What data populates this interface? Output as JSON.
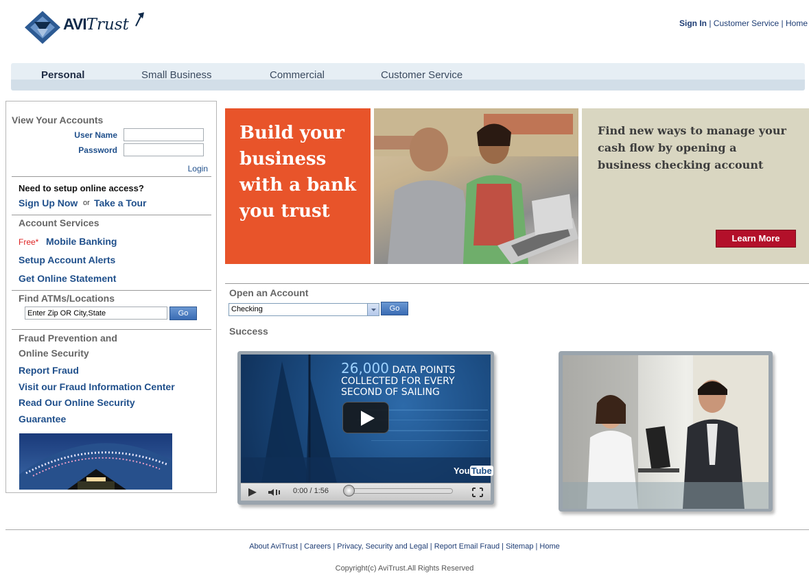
{
  "brand": {
    "logo_text_a": "AVI",
    "logo_text_b": "Trust"
  },
  "top_links": {
    "sign_in": "Sign In",
    "customer_service": "Customer Service",
    "home": "Home",
    "separator": "|"
  },
  "nav": {
    "personal": "Personal",
    "small_business": "Small Business",
    "commercial": "Commercial",
    "customer_service": "Customer Service"
  },
  "sidebar": {
    "view_accounts": "View Your Accounts",
    "user_name_label": "User Name",
    "password_label": "Password",
    "login": "Login",
    "setup_question": "Need to setup online access?",
    "sign_up": "Sign Up Now",
    "or": "or",
    "take_tour": "Take a Tour",
    "account_services": "Account Services",
    "free": "Free*",
    "mobile_banking": "Mobile Banking",
    "account_alerts": "Setup Account Alerts",
    "online_statement": "Get Online Statement",
    "find_atms": "Find ATMs/Locations",
    "zip_value": "Enter Zip OR City,State",
    "go": "Go",
    "fraud_title_1": "Fraud Prevention and",
    "fraud_title_2": "Online Security",
    "report_fraud": "Report Fraud",
    "fraud_center": "Visit our Fraud Information Center",
    "security_1": "Read Our Online Security",
    "security_2": "Guarantee"
  },
  "banner": {
    "headline": "Build your business with a bank you trust",
    "tagline": "Find new ways to manage your cash flow by opening a business checking account",
    "learn_more": "Learn More"
  },
  "open_account": {
    "title": "Open an Account",
    "selected": "Checking",
    "go": "Go"
  },
  "success": {
    "title": "Success"
  },
  "video": {
    "headline_big": "26,000",
    "headline_rest_1": "DATA POINTS",
    "headline_rest_2": "COLLECTED FOR EVERY",
    "headline_rest_3": "SECOND OF SAILING",
    "yt_a": "You",
    "yt_b": "Tube",
    "time": "0:00 / 1:56"
  },
  "footer": {
    "about": "About AviTrust",
    "careers": "Careers",
    "privacy": "Privacy, Security and Legal",
    "report_email": "Report Email Fraud",
    "sitemap": "Sitemap",
    "home": "Home",
    "sep": "|",
    "copyright": "Copyright(c) AviTrust.All Rights Reserved"
  },
  "colors": {
    "link": "#1f4f8b",
    "orange": "#e8542a",
    "beige": "#d9d6c1",
    "button_red": "#b3102a"
  },
  "icons": [
    "logo-diamond-icon",
    "arrow-up-icon",
    "play-icon",
    "volume-icon",
    "fullscreen-icon",
    "dropdown-arrow-icon"
  ]
}
